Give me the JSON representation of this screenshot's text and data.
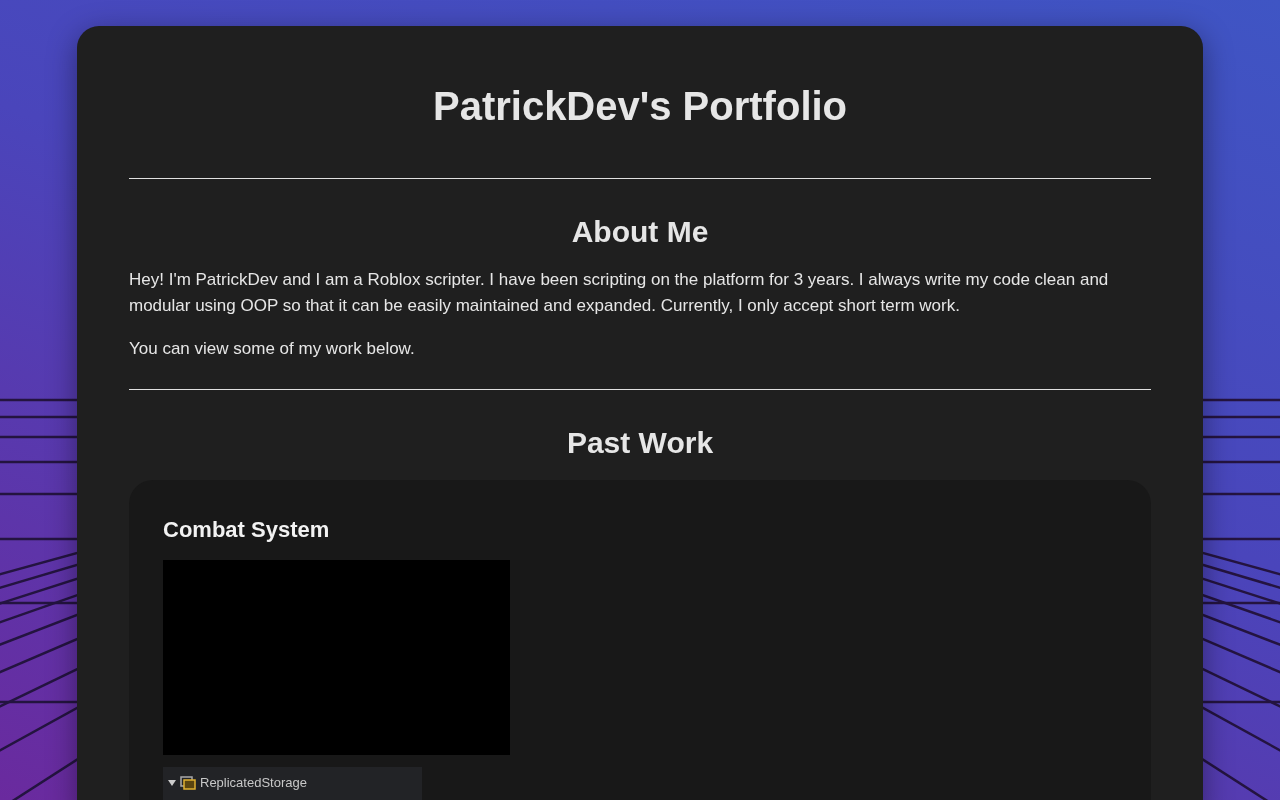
{
  "header": {
    "title": "PatrickDev's Portfolio"
  },
  "about": {
    "heading": "About Me",
    "paragraphs": [
      "Hey! I'm PatrickDev and I am a Roblox scripter. I have been scripting on the platform for 3 years. I always write my code clean and modular using OOP so that it can be easily maintained and expanded. Currently, I only accept short term work.",
      "You can view some of my work below."
    ]
  },
  "past_work": {
    "heading": "Past Work",
    "projects": [
      {
        "title": "Combat System",
        "media": [
          {
            "kind": "video"
          },
          {
            "kind": "explorer",
            "items": [
              {
                "label": "ReplicatedStorage",
                "expanded": true
              }
            ]
          }
        ]
      }
    ]
  }
}
